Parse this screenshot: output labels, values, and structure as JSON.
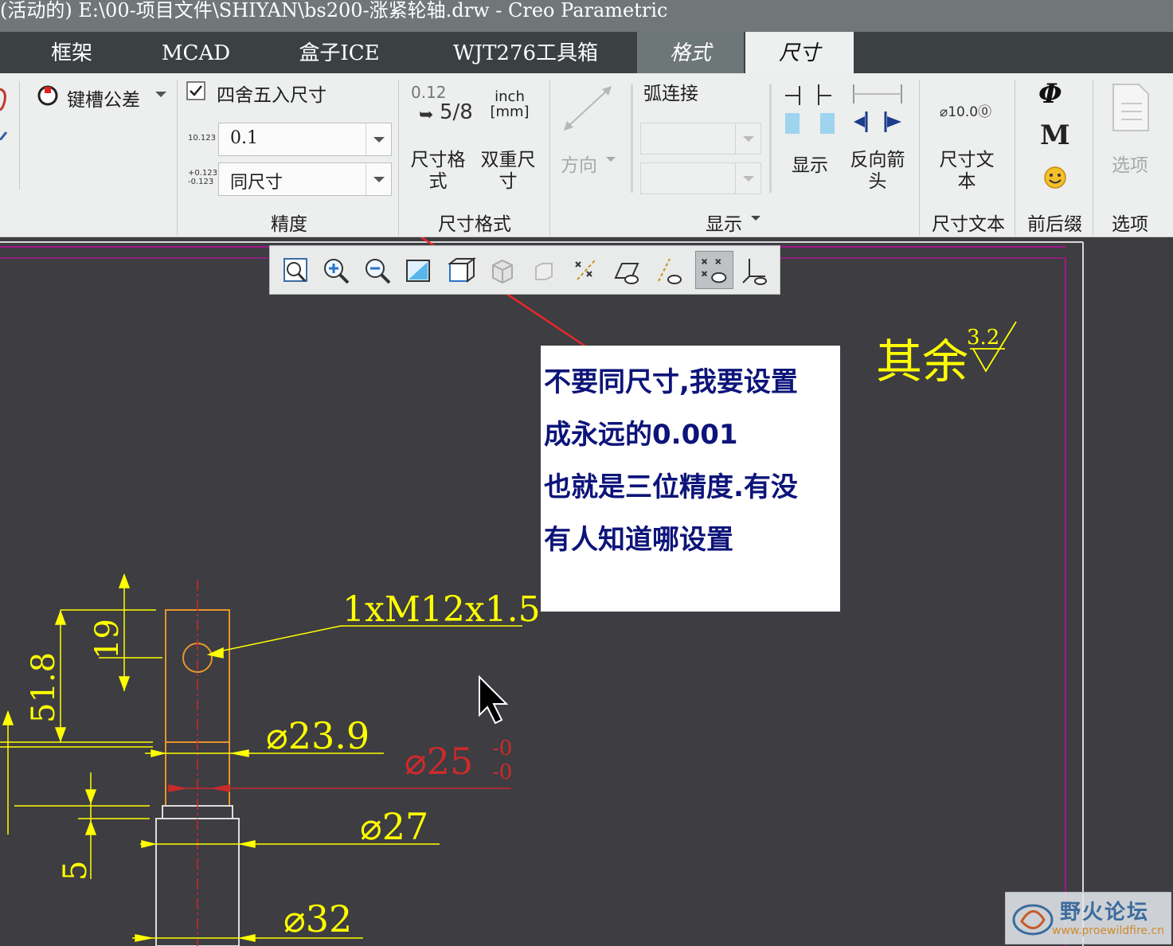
{
  "window": {
    "title": "(活动的) E:\\00-项目文件\\SHIYAN\\bs200-涨紧轮轴.drw - Creo Parametric"
  },
  "tabs": [
    {
      "label": "框架"
    },
    {
      "label": "MCAD"
    },
    {
      "label": "盒子ICE"
    },
    {
      "label": "WJT276工具箱"
    },
    {
      "label": "格式"
    },
    {
      "label": "尺寸"
    }
  ],
  "ribbon": {
    "keyway_tolerance": "键槽公差",
    "rounding_checkbox": "四舍五入尺寸",
    "decimal_places": "0.1",
    "tolerance_decimals": "同尺寸",
    "precision_group": "精度",
    "dim_format_icon": {
      "top": "0.12",
      "frac": "5/8"
    },
    "dim_format_button": "尺寸格\n式",
    "dual_dim_icon": {
      "top": "inch",
      "bottom": "[mm]"
    },
    "dual_dim_button": "双重尺\n寸",
    "dim_format_group": "尺寸格式",
    "direction_button": "方向",
    "arc_connect": "弧连接",
    "display_button": "显示",
    "reverse_arrow_button": "反向箭\n头",
    "display_group": "显示",
    "dim_text_icon": "⌀10.0⓪",
    "dim_text_button": "尺寸文\n本",
    "dim_text_group": "尺寸文本",
    "prefix_symbols": [
      "Φ",
      "M"
    ],
    "prefix_suffix_group": "前后缀",
    "options_button": "选项",
    "options_group": "选项"
  },
  "drawing": {
    "surface_note": "其余",
    "surface_value": "3.2",
    "thread_callout": "1xM12x1.5",
    "dims": {
      "d1": "19",
      "d2": "51.8",
      "d3": "⌀23.9",
      "d4_main": "⌀25",
      "d4_upper": "-0",
      "d4_lower": "-0",
      "d5": "⌀27",
      "d6": "5",
      "d7": "⌀32"
    }
  },
  "annotation": {
    "lines": [
      "不要同尺寸,我要设置",
      "成永远的0.001",
      "也就是三位精度.有没",
      "有人知道哪设置"
    ]
  },
  "watermark": {
    "name": "野火论坛",
    "url": "www.proewildfire.cn"
  },
  "colors": {
    "drawing_yellow": "#ffff00",
    "drawing_red": "#cc2a2a",
    "border_magenta": "#a3168a",
    "note_text": "#0d1479"
  }
}
